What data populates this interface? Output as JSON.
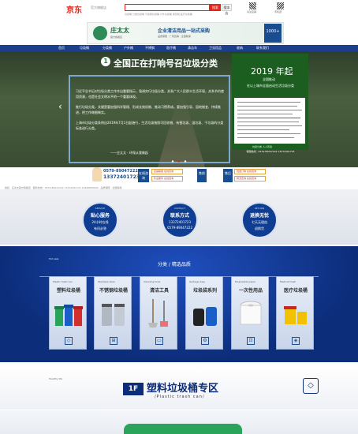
{
  "header": {
    "logo": "京东",
    "logo_sub": "官方旗舰店",
    "search_button": "搜索",
    "search_button2": "搜本店",
    "hot_words": "垃圾桶 分类垃圾桶 不锈钢垃圾桶 户外垃圾桶 果皮箱 医疗垃圾桶",
    "qr_label1": "关注店铺",
    "qr_label2": "手机逛"
  },
  "ad": {
    "brand": "庄太太",
    "brand_desc": "官方旗舰店",
    "title": "企业清洁用品一站式采购",
    "tags": "品质保障 · 厂家直销 · 全国联保",
    "right_label": "1000+"
  },
  "nav": [
    "首页",
    "垃圾桶",
    "分类桶",
    "户外桶",
    "不锈钢",
    "医疗桶",
    "清洁车",
    "卫浴用品",
    "收纳",
    "联系我们"
  ],
  "hero": {
    "badge": "1",
    "title": "全国正在打响号召垃圾分类",
    "body1": "习近平总书记对垃圾分类工作作出重要指示，强调实行垃圾分类，关系广大人民群众生活环境，关系节约使用资源，也是社会文明水平的一个重要体现。",
    "body2": "推行垃圾分类，关键是要加强科学管理、形成长效机制、推动习惯养成。要加强引导、因地制宜、持续推进，把工作做细做实。",
    "body3": "上海市垃圾分类条例自2019年7月1日起施行，生活垃圾按照可回收物、有害垃圾、湿垃圾、干垃圾的分类标准进行分类。",
    "signature": "——庄太太 · 环保从我做起",
    "arrow_left": "‹",
    "arrow_right": "›"
  },
  "side": {
    "title": "2019 年起",
    "sub1": "全国推动",
    "sub2": "在以上城市全面启动生活垃圾分类",
    "foot": "垃圾分类 人人有责",
    "contact": "客服热线：0579-89047222 13372401723"
  },
  "contact": {
    "hotline_label": "服务热线",
    "hotline": "0579-89047222",
    "phone": "13372401723",
    "button1": "在线咨询",
    "box1": "店铺客服 在线咨询",
    "box2": "售后服务 在线咨询",
    "box3": "批发订购 在线咨询",
    "box4": "物流查询 在线咨询",
    "button2": "售前",
    "button3": "售后",
    "copyright": "版权 · 庄太太官方旗舰店 · 服务热线：0579-89047222 13372401723 13966809000 · 品质保障 · 全国联保"
  },
  "services": [
    {
      "top": "SERVICE",
      "title": "贴心服务",
      "line1": "24小时在线",
      "line2": "有问必答"
    },
    {
      "top": "CONTACT",
      "title": "联系方式",
      "line1": "13372401723",
      "line2": "0579-89047222"
    },
    {
      "top": "RETURN",
      "title": "退换无忧",
      "line1": "七天无理由",
      "line2": "退换货"
    }
  ],
  "category": {
    "head_left": "Hot sale",
    "title": "分类 / 精选品质",
    "cards": [
      {
        "head": "Plastic trash can",
        "name": "塑料垃圾桶",
        "icon": "◇"
      },
      {
        "head": "Stainless steel",
        "name": "不锈钢垃圾桶",
        "icon": "⊞"
      },
      {
        "head": "Cleaning tools",
        "name": "清洁工具",
        "icon": "▭"
      },
      {
        "head": "Garbage bag",
        "name": "垃圾袋系列",
        "icon": "⚙"
      },
      {
        "head": "Disposable paper",
        "name": "一次性用品",
        "icon": "⊡"
      },
      {
        "head": "Medical trash",
        "name": "医疗垃圾桶",
        "icon": "◈"
      }
    ]
  },
  "floor": {
    "corner": "Healthy life",
    "tag": "1F",
    "title": "塑料垃圾桶专区",
    "sub": "/Plastic trash can/",
    "icon": "◇"
  },
  "colors": {
    "brand_red": "#e1251b",
    "navy": "#0c2d7a",
    "green": "#1b5e20"
  }
}
